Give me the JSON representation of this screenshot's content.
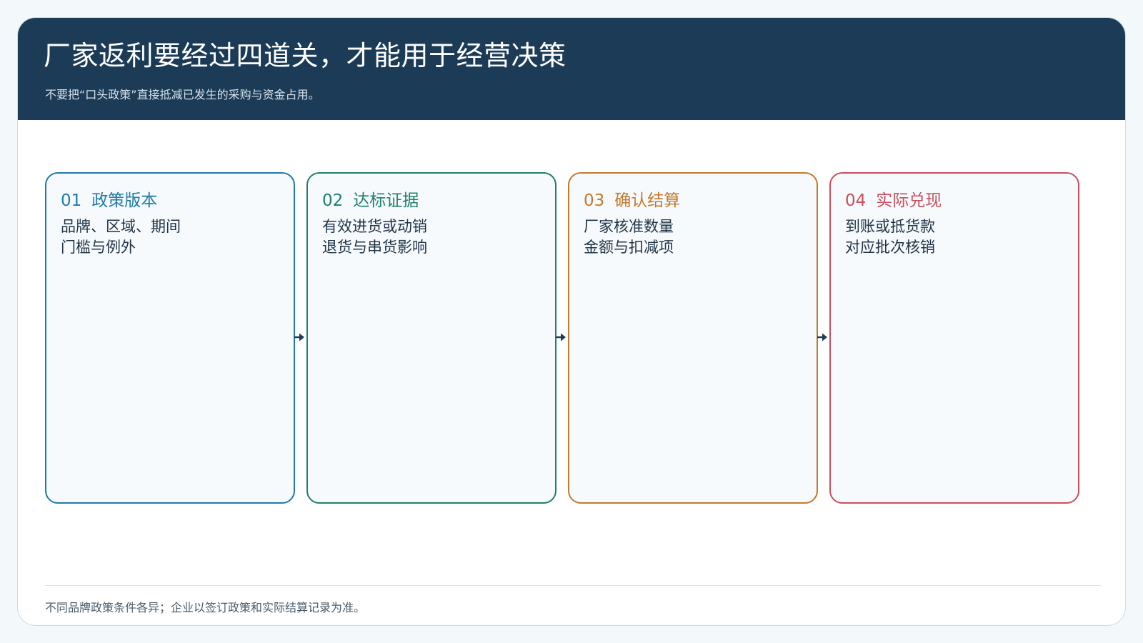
{
  "header": {
    "title": "厂家返利要经过四道关，才能用于经营决策",
    "subtitle": "不要把“口头政策”直接抵减已发生的采购与资金占用。"
  },
  "steps": [
    {
      "number": "01",
      "title": "政策版本",
      "lines": [
        "品牌、区域、期间",
        "门槛与例外"
      ],
      "color": "#1f7aa8"
    },
    {
      "number": "02",
      "title": "达标证据",
      "lines": [
        "有效进货或动销",
        "退货与串货影响"
      ],
      "color": "#1f7f6a"
    },
    {
      "number": "03",
      "title": "确认结算",
      "lines": [
        "厂家核准数量",
        "金额与扣减项"
      ],
      "color": "#c27a2c"
    },
    {
      "number": "04",
      "title": "实际兑现",
      "lines": [
        "到账或抵货款",
        "对应批次核销"
      ],
      "color": "#c94f5c"
    }
  ],
  "arrow_icon": "arrow-right-icon",
  "arrow_color": "#1b3b57",
  "footnote": "不同品牌政策条件各异；企业以签订政策和实际结算记录为准。"
}
